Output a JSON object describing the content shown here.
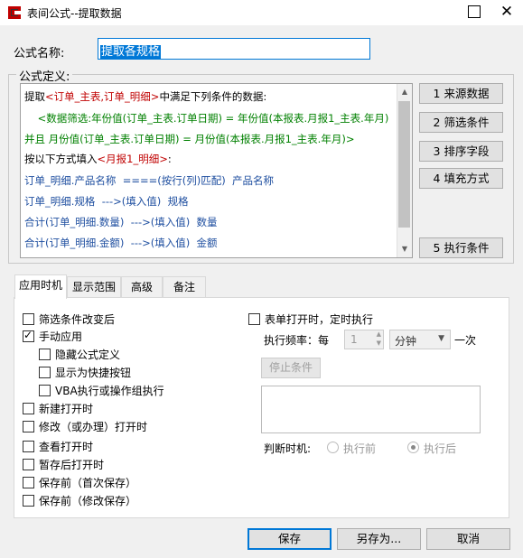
{
  "window": {
    "title": "表间公式--提取数据"
  },
  "formula_name": {
    "label": "公式名称:",
    "value": "提取各规格"
  },
  "formula_def": {
    "label": "公式定义:",
    "lines": [
      {
        "parts": [
          {
            "text": "提取",
            "color": "#000000"
          },
          {
            "text": "<订单_主表,订单_明细>",
            "color": "#c00000"
          },
          {
            "text": "中满足下列条件的数据:",
            "color": "#000000"
          }
        ]
      },
      {
        "parts": [
          {
            "text": "    <数据筛选:年份值(订单_主表.订单日期) = 年份值(本报表.月报1_主表.年月)",
            "color": "#008000"
          }
        ]
      },
      {
        "parts": [
          {
            "text": "并且 月份值(订单_主表.订单日期) = 月份值(本报表.月报1_主表.年月)>",
            "color": "#008000"
          }
        ]
      },
      {
        "parts": [
          {
            "text": "按以下方式填入",
            "color": "#000000"
          },
          {
            "text": "<月报1_明细>",
            "color": "#c00000"
          },
          {
            "text": ":",
            "color": "#000000"
          }
        ]
      },
      {
        "parts": [
          {
            "text": "订单_明细.产品名称  ====(按行(列)匹配)  产品名称",
            "color": "#1f4fa0"
          }
        ]
      },
      {
        "parts": [
          {
            "text": "订单_明细.规格  --->(填入值)  规格",
            "color": "#1f4fa0"
          }
        ]
      },
      {
        "parts": [
          {
            "text": "合计(订单_明细.数量)  --->(填入值)  数量",
            "color": "#1f4fa0"
          }
        ]
      },
      {
        "parts": [
          {
            "text": "合计(订单_明细.金额)  --->(填入值)  金额",
            "color": "#1f4fa0"
          }
        ]
      }
    ]
  },
  "side_buttons": {
    "source": "1  来源数据",
    "filter": "2  筛选条件",
    "sort": "3  排序字段",
    "fill": "4 填充方式",
    "exec": "5 执行条件"
  },
  "tabs": [
    "应用时机",
    "显示范围",
    "高级",
    "备注"
  ],
  "options": {
    "filter_change": "筛选条件改变后",
    "manual_apply": "手动应用",
    "hide_def": "隐藏公式定义",
    "show_shortcut": "显示为快捷按钮",
    "vba_exec": "VBA执行或操作组执行",
    "new_open": "新建打开时",
    "modify_open": "修改（或办理）打开时",
    "view_open": "查看打开时",
    "after_temp_save": "暂存后打开时",
    "before_save_first": "保存前（首次保存）",
    "before_save_modify": "保存前（修改保存）",
    "timed_exec": "表单打开时，定时执行",
    "freq_label": "执行频率：每",
    "freq_value": "1",
    "freq_unit": "分钟",
    "freq_suffix": "一次",
    "stop_condition": "停止条件",
    "judge_label": "判断时机:",
    "judge_before": "执行前",
    "judge_after": "执行后"
  },
  "bottom_buttons": {
    "save": "保存",
    "save_as": "另存为...",
    "cancel": "取消"
  }
}
